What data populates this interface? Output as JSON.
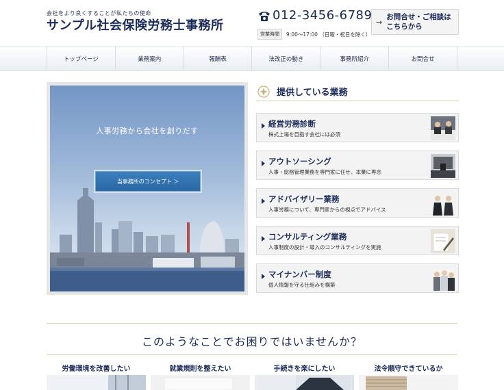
{
  "header": {
    "tagline": "会社をより良くすることが私たちの使命",
    "title": "サンプル社会保険労務士事務所",
    "phone": "012-3456-6789",
    "hours_badge": "営業時間",
    "hours_text": "9:00～17:00 （日曜・祝日を除く）",
    "contact_label": "お問合せ・ご相談は\nこちらから"
  },
  "nav": {
    "items": [
      "トップページ",
      "業務案内",
      "報酬表",
      "法改正の動き",
      "事務所紹介",
      "お問合せ"
    ]
  },
  "hero": {
    "text": "人事労務から会社を創りだす",
    "button": "当事務所のコンセプト ＞"
  },
  "services": {
    "heading": "提供している業務",
    "items": [
      {
        "title": "経営労務診断",
        "desc": "株式上場を目指す会社には必須",
        "icon": "meeting-photo"
      },
      {
        "title": "アウトソーシング",
        "desc": "人事・総務管理業務を専門家に任せ、本業に専念",
        "icon": "office-photo"
      },
      {
        "title": "アドバイザリー業務",
        "desc": "人事労務について、専門家からの視点でアドバイス",
        "icon": "advisor-photo"
      },
      {
        "title": "コンサルティング業務",
        "desc": "人事制度の設計・導入のコンサルティングを実施",
        "icon": "writing-photo"
      },
      {
        "title": "マイナンバー制度",
        "desc": "個人情報を守る仕組みを構築",
        "icon": "people-photo"
      }
    ]
  },
  "trouble": {
    "heading": "このようなことでお困りではいませんか？",
    "items": [
      "労働環境を改善したい",
      "就業規則を整えたい",
      "手続きを楽にしたい",
      "法令順守できているか"
    ]
  },
  "colors": {
    "navy": "#1c2c5a",
    "gold": "#c9b27a",
    "hero_button": "#2a67a3"
  }
}
